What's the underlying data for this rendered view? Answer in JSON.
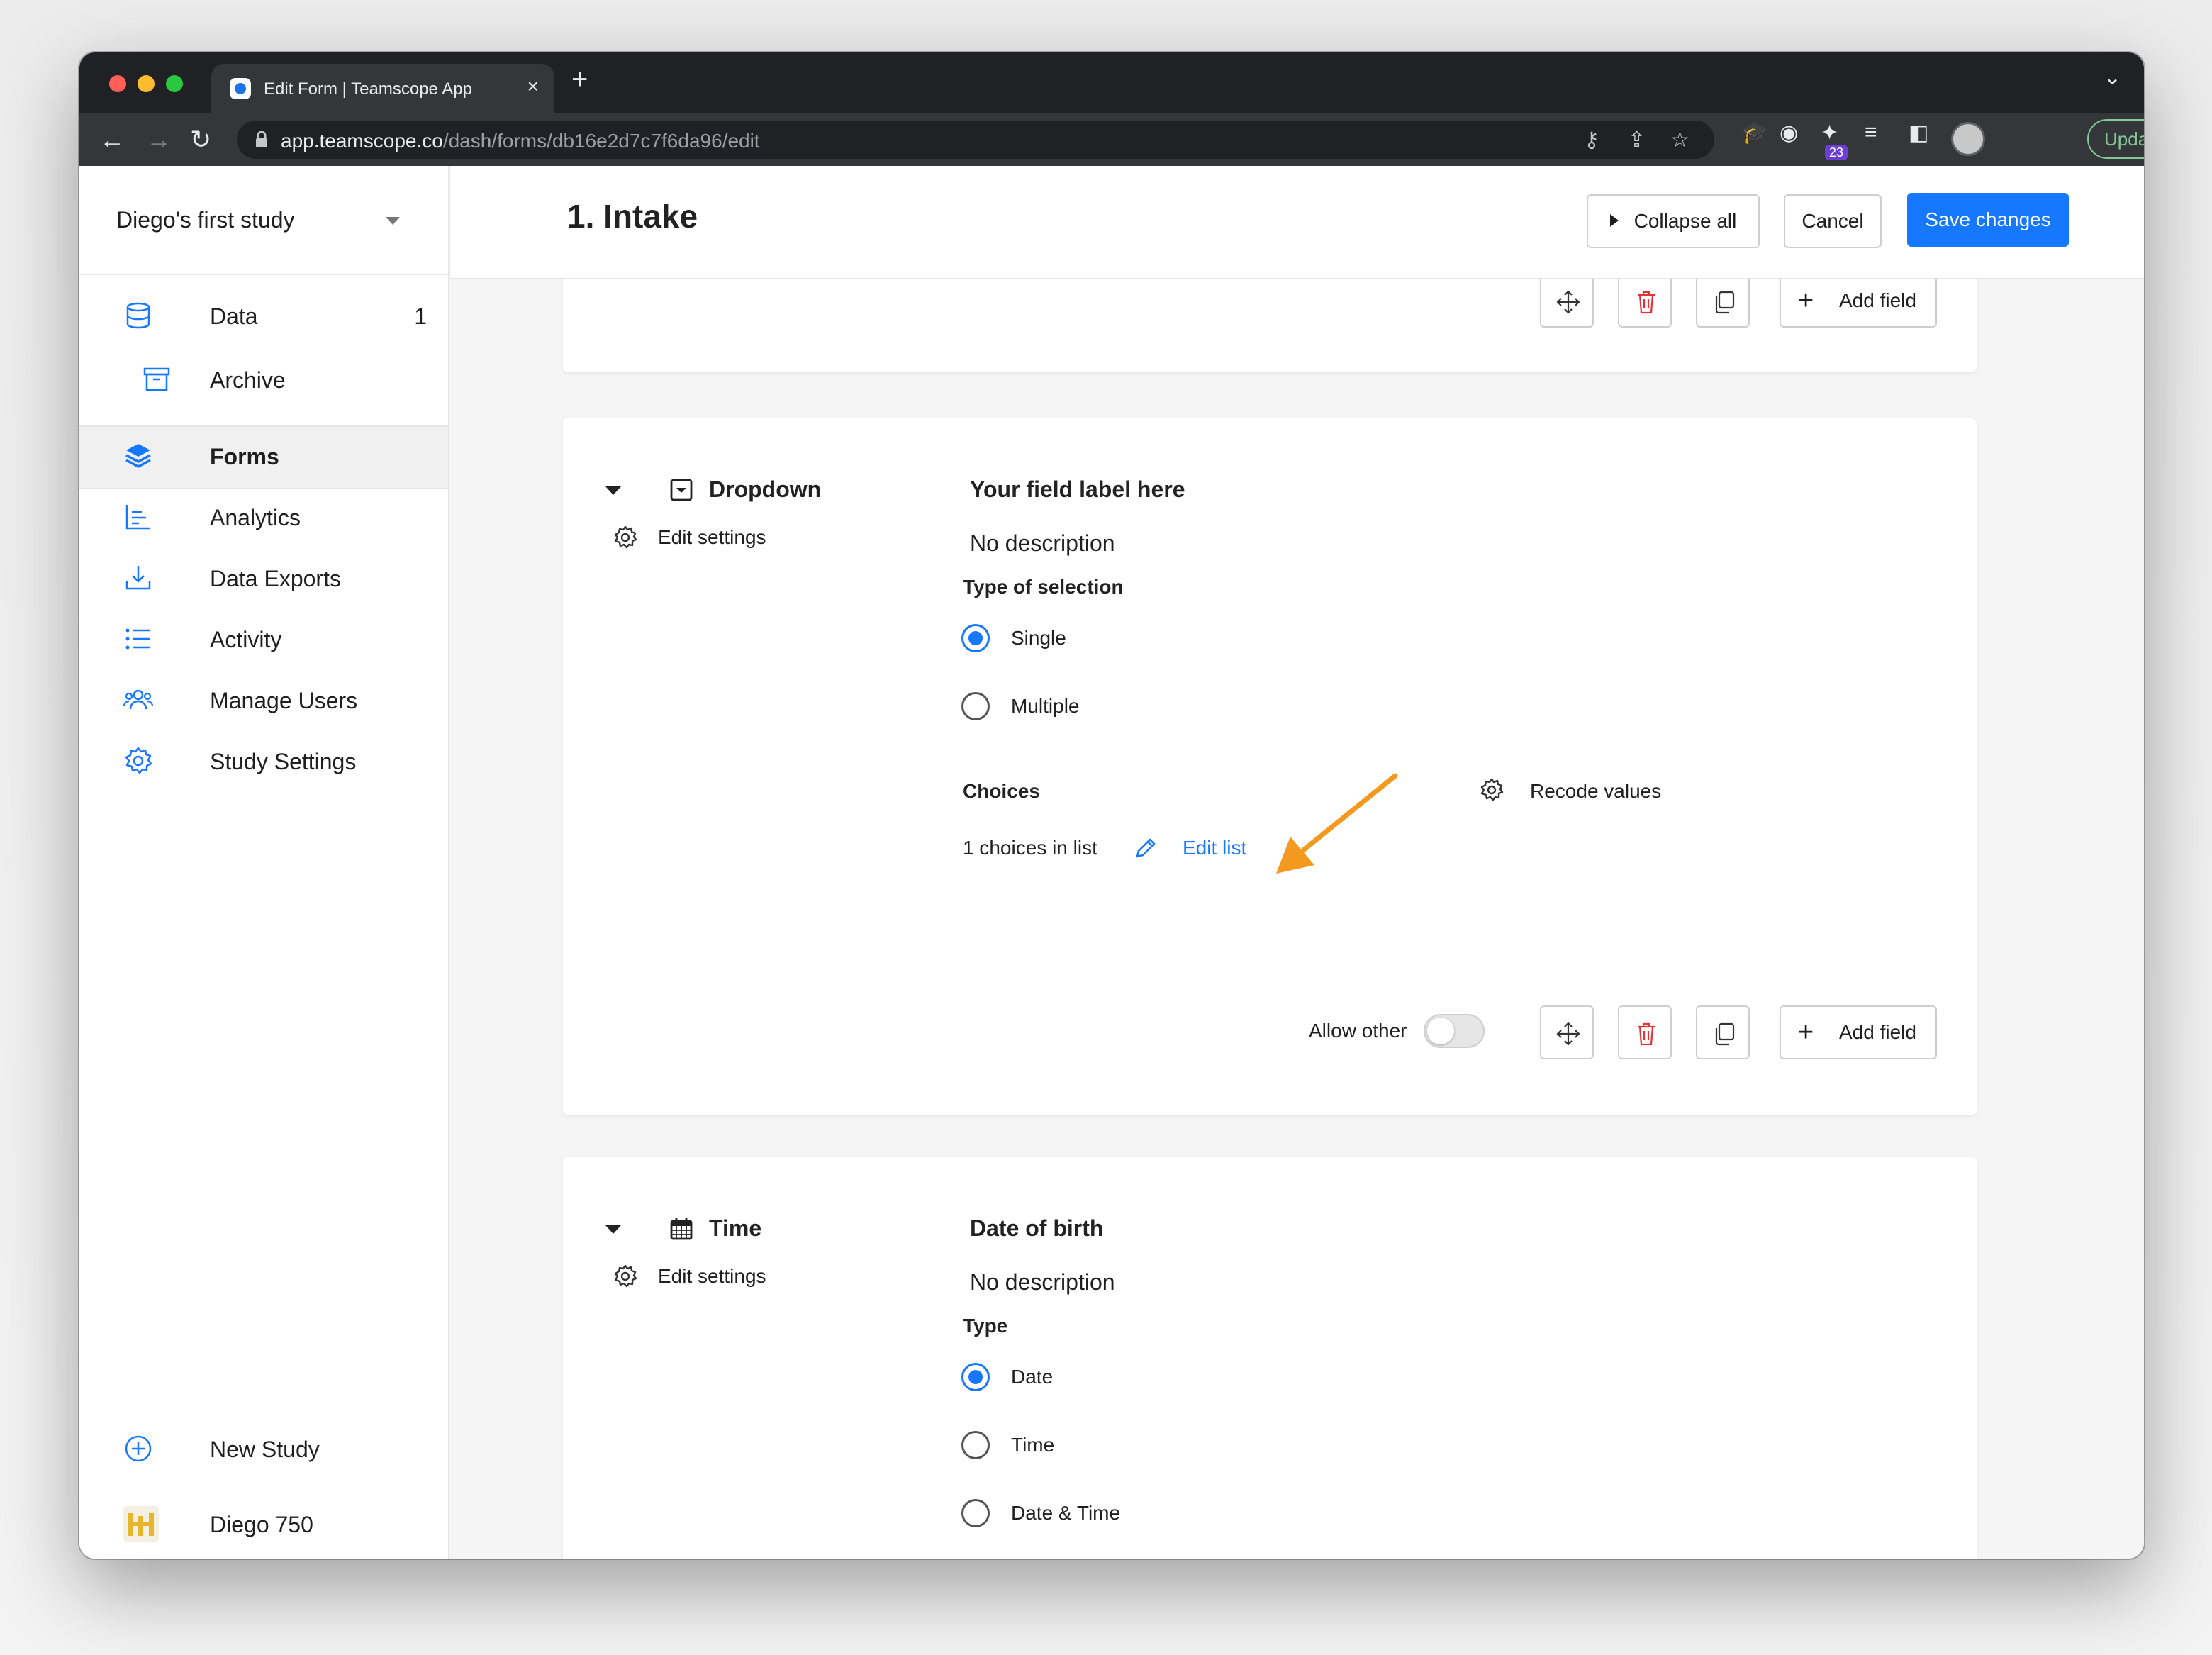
{
  "browser": {
    "tab_title": "Edit Form | Teamscope App",
    "url_host": "app.teamscope.co",
    "url_path": "/dash/forms/db16e2d7c7f6da96/edit",
    "extension_badge": "23",
    "update_label": "Update"
  },
  "sidebar": {
    "study_name": "Diego's first study",
    "items": [
      {
        "label": "Data",
        "count": "1",
        "icon": "database-icon"
      },
      {
        "label": "Archive",
        "icon": "archive-icon"
      },
      {
        "label": "Forms",
        "icon": "layers-icon",
        "active": true
      },
      {
        "label": "Analytics",
        "icon": "chart-icon"
      },
      {
        "label": "Data Exports",
        "icon": "download-icon"
      },
      {
        "label": "Activity",
        "icon": "list-icon"
      },
      {
        "label": "Manage Users",
        "icon": "users-icon"
      },
      {
        "label": "Study Settings",
        "icon": "gear-icon"
      }
    ],
    "new_study": "New Study",
    "user_name": "Diego 750"
  },
  "header": {
    "title": "1. Intake",
    "collapse_label": "Collapse all",
    "cancel_label": "Cancel",
    "save_label": "Save changes"
  },
  "cards": {
    "top": {
      "add_field_label": "Add field"
    },
    "dropdown": {
      "type_name": "Dropdown",
      "edit_settings": "Edit settings",
      "field_label": "Your field label here",
      "description": "No description",
      "selection_title": "Type of selection",
      "options": [
        "Single",
        "Multiple"
      ],
      "selected": "Single",
      "choices_title": "Choices",
      "recode_label": "Recode values",
      "choices_count": "1 choices in list",
      "edit_list_label": "Edit list",
      "allow_other_label": "Allow other",
      "allow_other_on": false,
      "add_field_label": "Add field"
    },
    "time": {
      "type_name": "Time",
      "edit_settings": "Edit settings",
      "field_label": "Date of birth",
      "description": "No description",
      "type_title": "Type",
      "options": [
        "Date",
        "Time",
        "Date & Time"
      ],
      "selected": "Date"
    }
  },
  "colors": {
    "accent": "#1677ff",
    "danger": "#e0343a",
    "annotation_arrow": "#f39a1e"
  }
}
